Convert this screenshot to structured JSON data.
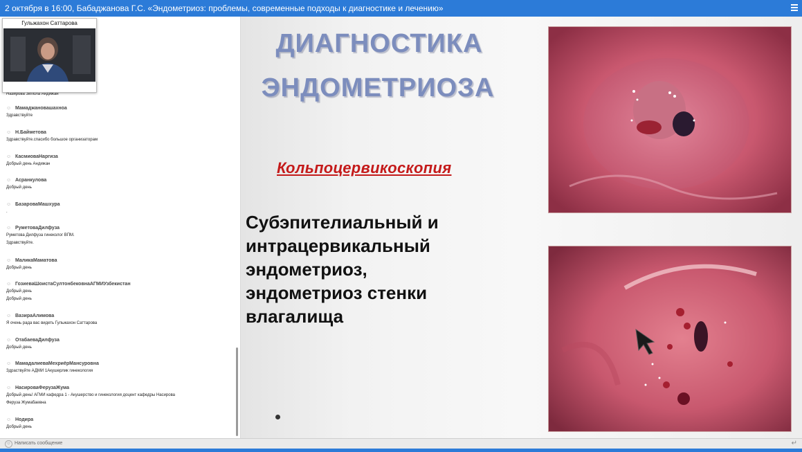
{
  "title": "2 октября в 16:00, Бабаджанова Г.С. «Эндометриоз: проблемы, современные подходы к диагностике и лечению»",
  "video": {
    "presenter": "Гульжахон Саттарова"
  },
  "chat": {
    "partial_message": "Назирова Зилола Андижан",
    "messages": [
      {
        "author": "Мамаджановашахноа",
        "lines": [
          "Здравствуйте"
        ]
      },
      {
        "author": "Н.Байметова",
        "lines": [
          "Здравствуйте.спасибо большое организаторам"
        ]
      },
      {
        "author": "КасмиоваНаргиза",
        "lines": [
          "Добрый день Андижан"
        ]
      },
      {
        "author": "Асранкулова",
        "lines": [
          "Добрый день"
        ]
      },
      {
        "author": "БазароваМашхура",
        "lines": [
          "."
        ]
      },
      {
        "author": "РуметоваДилфуза",
        "lines": [
          "Руметова Дилфуза гинеколог ВПМ.",
          "Здравствуйте."
        ]
      },
      {
        "author": "МаликаМаматова",
        "lines": [
          "Добрый день"
        ]
      },
      {
        "author": "ГозиеваШоистаСултонбековнаАГМИУзбекистан",
        "lines": [
          "Добрый день",
          "Добрый день"
        ]
      },
      {
        "author": "ВазираАлимова",
        "lines": [
          "Я очень рада вас видеть Гульжахон Саттарова"
        ]
      },
      {
        "author": "ОтабаеваДилфуза",
        "lines": [
          "Добрый день"
        ]
      },
      {
        "author": "МамадалиеваМехриёрМансуровна",
        "lines": [
          "Здраствуйте АДМИ 1Акушерлик гинекология"
        ]
      },
      {
        "author": "НасироваФерузаЖума",
        "lines": [
          "Добрый день! АГМИ кафедра 1 - Акушерство и гинекология доцент кафедры Насирова",
          "Феруза Жумабаевна"
        ]
      },
      {
        "author": "Нодира",
        "lines": [
          "Добрый день"
        ]
      }
    ],
    "input_placeholder": "Написать сообщение"
  },
  "slide": {
    "title_line1": "ДИАГНОСТИКА",
    "title_line2": "ЭНДОМЕТРИОЗА",
    "subheading": "Кольпоцервикоскопия",
    "body_lines": [
      "Субэпителиальный и",
      "интрацервикальный",
      "эндометриоз,",
      "эндометриоз стенки",
      "влагалища"
    ]
  },
  "colors": {
    "titlebar": "#2c7bd8",
    "slide_title": "#7c8dbd",
    "subheading": "#c41a1a"
  },
  "icons": {
    "menu": "hamburger-icon",
    "user": "user-icon",
    "emoji": "smile-icon",
    "send": "enter-icon",
    "pointer": "cursor-arrow-icon"
  }
}
